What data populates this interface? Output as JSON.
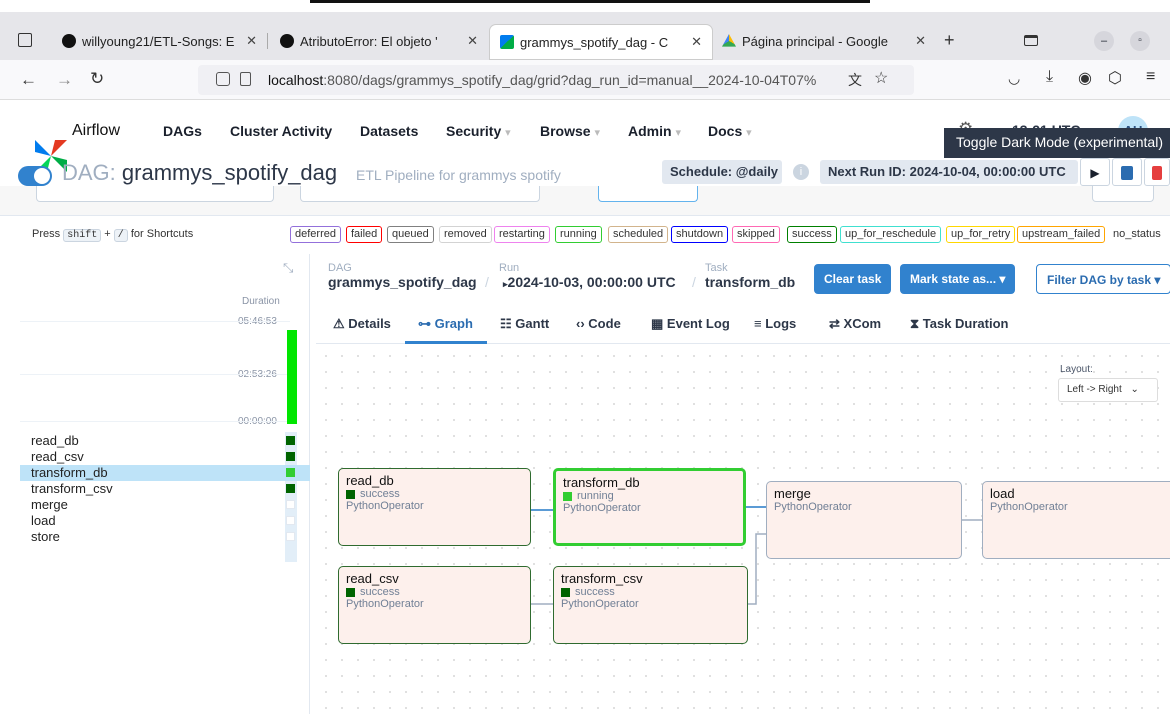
{
  "browser": {
    "tabs": [
      {
        "title": "willyoung21/ETL-Songs: E"
      },
      {
        "title": "AtributoError: El objeto '"
      },
      {
        "title": "grammys_spotify_dag - C"
      },
      {
        "title": "Página principal - Google"
      }
    ],
    "new_tab": "+",
    "url_host": "localhost",
    "url_rest": ":8080/dags/grammys_spotify_dag/grid?dag_run_id=manual__2024-10-04T07%"
  },
  "airflow": {
    "logo_text": "Airflow",
    "menu": [
      "DAGs",
      "Cluster Activity",
      "Datasets",
      "Security",
      "Browse",
      "Admin",
      "Docs"
    ],
    "time": "13:21 UTC",
    "user": "AU",
    "tooltip": "Toggle Dark Mode (experimental)",
    "dag_label": "DAG:",
    "dag_id": "grammys_spotify_dag",
    "dag_desc": "ETL Pipeline for grammys spotify",
    "schedule": "Schedule: @daily",
    "next_run": "Next Run ID: 2024-10-04, 00:00:00 UTC"
  },
  "legend": {
    "shortcuts_prefix": "Press",
    "key1": "shift",
    "plus": "+",
    "key2": "/",
    "shortcuts_suffix": "for Shortcuts",
    "states": [
      {
        "label": "deferred",
        "color": "#9370db"
      },
      {
        "label": "failed",
        "color": "#ff0000"
      },
      {
        "label": "queued",
        "color": "#808080"
      },
      {
        "label": "removed",
        "color": "#d3d3d3"
      },
      {
        "label": "restarting",
        "color": "#ee82ee"
      },
      {
        "label": "running",
        "color": "#32cd32"
      },
      {
        "label": "scheduled",
        "color": "#d2b48c"
      },
      {
        "label": "shutdown",
        "color": "#0000ff"
      },
      {
        "label": "skipped",
        "color": "#ff69b4"
      },
      {
        "label": "success",
        "color": "#008000"
      },
      {
        "label": "up_for_reschedule",
        "color": "#40e0d0"
      },
      {
        "label": "up_for_retry",
        "color": "#ffd700"
      },
      {
        "label": "upstream_failed",
        "color": "#ffa500"
      }
    ],
    "no_status": "no_status"
  },
  "grid": {
    "duration_label": "Duration",
    "ticks": [
      "05:46:53",
      "02:53:26",
      "00:00:00"
    ],
    "tasks": [
      {
        "name": "read_db",
        "state": "success"
      },
      {
        "name": "read_csv",
        "state": "success"
      },
      {
        "name": "transform_db",
        "state": "running"
      },
      {
        "name": "transform_csv",
        "state": "success"
      },
      {
        "name": "merge",
        "state": "none"
      },
      {
        "name": "load",
        "state": "none"
      },
      {
        "name": "store",
        "state": "none"
      }
    ]
  },
  "detail": {
    "bc_dag": "DAG",
    "bc_dag_val": "grammys_spotify_dag",
    "bc_run": "Run",
    "bc_run_val": "2024-10-03, 00:00:00 UTC",
    "bc_task": "Task",
    "bc_task_val": "transform_db",
    "clear_task": "Clear task",
    "mark_state": "Mark state as...",
    "filter": "Filter DAG by task",
    "tabs": [
      "Details",
      "Graph",
      "Gantt",
      "Code",
      "Event Log",
      "Logs",
      "XCom",
      "Task Duration"
    ]
  },
  "graph": {
    "layout_label": "Layout:",
    "layout_value": "Left -> Right",
    "nodes": [
      {
        "name": "read_db",
        "status": "success",
        "operator": "PythonOperator"
      },
      {
        "name": "transform_db",
        "status": "running",
        "operator": "PythonOperator"
      },
      {
        "name": "merge",
        "operator": "PythonOperator"
      },
      {
        "name": "load",
        "operator": "PythonOperator"
      },
      {
        "name": "read_csv",
        "status": "success",
        "operator": "PythonOperator"
      },
      {
        "name": "transform_csv",
        "status": "success",
        "operator": "PythonOperator"
      }
    ]
  }
}
